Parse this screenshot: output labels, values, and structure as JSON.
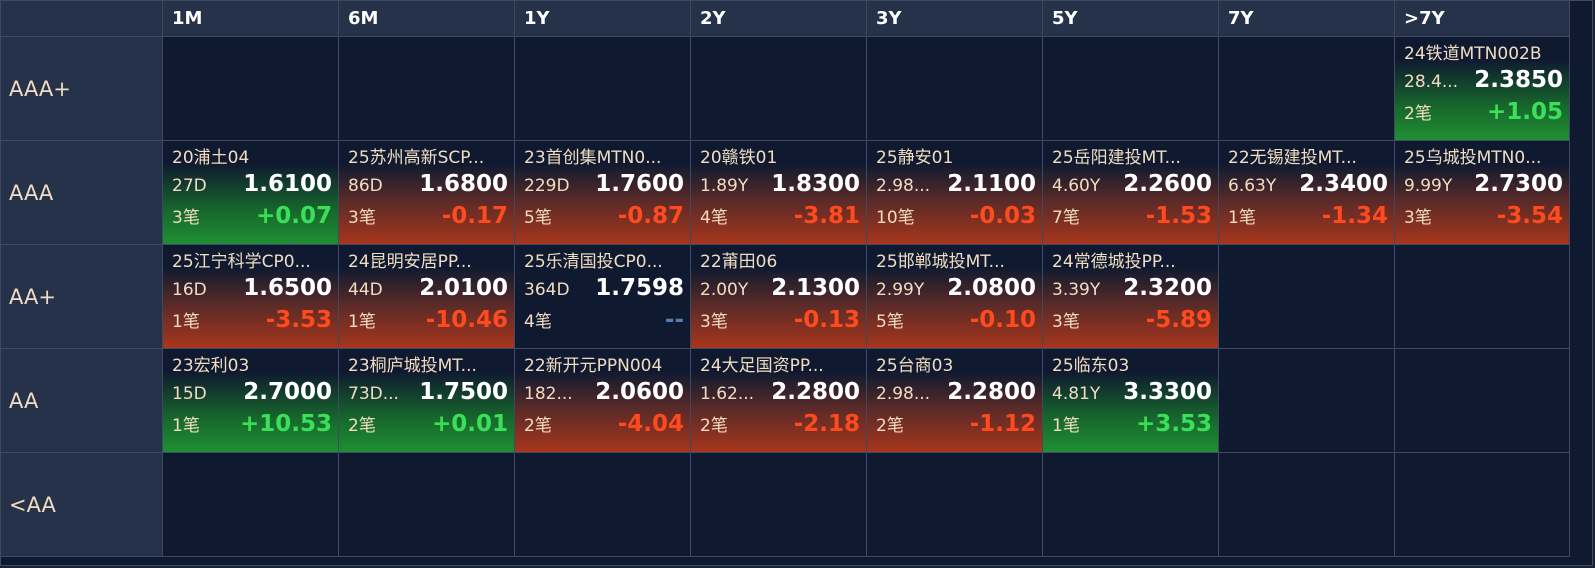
{
  "columns": [
    "1M",
    "6M",
    "1Y",
    "2Y",
    "3Y",
    "5Y",
    "7Y",
    ">7Y"
  ],
  "rows": [
    {
      "rating": "AAA+",
      "cells": [
        null,
        null,
        null,
        null,
        null,
        null,
        null,
        {
          "name": "24铁道MTN002B",
          "term": "28.4...",
          "yield": "2.3850",
          "count": "2笔",
          "change": "+1.05",
          "dir": "up"
        }
      ]
    },
    {
      "rating": "AAA",
      "cells": [
        {
          "name": "20浦土04",
          "term": "27D",
          "yield": "1.6100",
          "count": "3笔",
          "change": "+0.07",
          "dir": "up"
        },
        {
          "name": "25苏州高新SCP...",
          "term": "86D",
          "yield": "1.6800",
          "count": "3笔",
          "change": "-0.17",
          "dir": "down"
        },
        {
          "name": "23首创集MTN0...",
          "term": "229D",
          "yield": "1.7600",
          "count": "5笔",
          "change": "-0.87",
          "dir": "down"
        },
        {
          "name": "20赣铁01",
          "term": "1.89Y",
          "yield": "1.8300",
          "count": "4笔",
          "change": "-3.81",
          "dir": "down"
        },
        {
          "name": "25静安01",
          "term": "2.98...",
          "yield": "2.1100",
          "count": "10笔",
          "change": "-0.03",
          "dir": "down"
        },
        {
          "name": "25岳阳建投MT...",
          "term": "4.60Y",
          "yield": "2.2600",
          "count": "7笔",
          "change": "-1.53",
          "dir": "down"
        },
        {
          "name": "22无锡建投MT...",
          "term": "6.63Y",
          "yield": "2.3400",
          "count": "1笔",
          "change": "-1.34",
          "dir": "down"
        },
        {
          "name": "25乌城投MTN0...",
          "term": "9.99Y",
          "yield": "2.7300",
          "count": "3笔",
          "change": "-3.54",
          "dir": "down"
        }
      ]
    },
    {
      "rating": "AA+",
      "cells": [
        {
          "name": "25江宁科学CP0...",
          "term": "16D",
          "yield": "1.6500",
          "count": "1笔",
          "change": "-3.53",
          "dir": "down"
        },
        {
          "name": "24昆明安居PP...",
          "term": "44D",
          "yield": "2.0100",
          "count": "1笔",
          "change": "-10.46",
          "dir": "down"
        },
        {
          "name": "25乐清国投CP0...",
          "term": "364D",
          "yield": "1.7598",
          "count": "4笔",
          "change": "--",
          "dir": "flat"
        },
        {
          "name": "22莆田06",
          "term": "2.00Y",
          "yield": "2.1300",
          "count": "3笔",
          "change": "-0.13",
          "dir": "down"
        },
        {
          "name": "25邯郸城投MT...",
          "term": "2.99Y",
          "yield": "2.0800",
          "count": "5笔",
          "change": "-0.10",
          "dir": "down"
        },
        {
          "name": "24常德城投PP...",
          "term": "3.39Y",
          "yield": "2.3200",
          "count": "3笔",
          "change": "-5.89",
          "dir": "down"
        },
        null,
        null
      ]
    },
    {
      "rating": "AA",
      "cells": [
        {
          "name": "23宏利03",
          "term": "15D",
          "yield": "2.7000",
          "count": "1笔",
          "change": "+10.53",
          "dir": "up"
        },
        {
          "name": "23桐庐城投MT...",
          "term": "73D...",
          "yield": "1.7500",
          "count": "2笔",
          "change": "+0.01",
          "dir": "up"
        },
        {
          "name": "22新开元PPN004",
          "term": "182...",
          "yield": "2.0600",
          "count": "2笔",
          "change": "-4.04",
          "dir": "down"
        },
        {
          "name": "24大足国资PP...",
          "term": "1.62...",
          "yield": "2.2800",
          "count": "2笔",
          "change": "-2.18",
          "dir": "down"
        },
        {
          "name": "25台商03",
          "term": "2.98...",
          "yield": "2.2800",
          "count": "2笔",
          "change": "-1.12",
          "dir": "down"
        },
        {
          "name": "25临东03",
          "term": "4.81Y",
          "yield": "3.3300",
          "count": "1笔",
          "change": "+3.53",
          "dir": "up"
        },
        null,
        null
      ]
    },
    {
      "rating": "<AA",
      "cells": [
        null,
        null,
        null,
        null,
        null,
        null,
        null,
        null
      ]
    }
  ]
}
